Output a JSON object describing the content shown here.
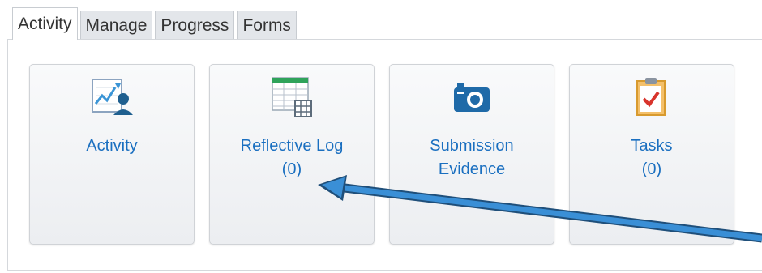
{
  "tabs": [
    "Activity",
    "Manage",
    "Progress",
    "Forms"
  ],
  "active_tab": "Activity",
  "tiles": [
    {
      "line1": "Activity",
      "line2": "",
      "icon": "chart-person-icon"
    },
    {
      "line1": "Reflective Log",
      "line2": "(0)",
      "icon": "spreadsheet-icon"
    },
    {
      "line1": "Submission",
      "line2": "Evidence",
      "icon": "camera-icon"
    },
    {
      "line1": "Tasks",
      "line2": "(0)",
      "icon": "clipboard-check-icon"
    }
  ],
  "colors": {
    "link": "#1a6fc0",
    "annotation_arrow": "#3a8fd6"
  }
}
